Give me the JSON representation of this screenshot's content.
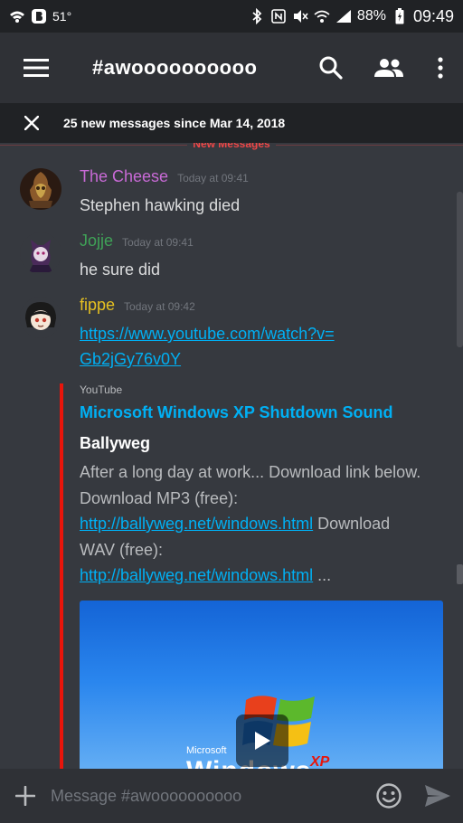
{
  "status_bar": {
    "temperature": "51°",
    "battery": "88%",
    "time": "09:49"
  },
  "header": {
    "channel_name": "#awoooooooooo"
  },
  "new_messages_bar": {
    "text": "25 new messages since Mar 14, 2018",
    "divider_label": "New Messages"
  },
  "messages": [
    {
      "author": "The Cheese",
      "author_color": "#c86ad6",
      "timestamp": "Today at 09:41",
      "text": "Stephen hawking died"
    },
    {
      "author": "Jojje",
      "author_color": "#3fa257",
      "timestamp": "Today at 09:41",
      "text": "he sure did"
    },
    {
      "author": "fippe",
      "author_color": "#e6c021",
      "timestamp": "Today at 09:42",
      "link_line1": "https://www.youtube.com/watch?v=",
      "link_line2": "Gb2jGy76v0Y"
    }
  ],
  "embed": {
    "provider": "YouTube",
    "title": "Microsoft Windows XP Shutdown Sound",
    "author": "Ballyweg",
    "desc_1": "After a long day at work... Download link below.",
    "desc_2": "Download MP3 (free):",
    "desc_link_1": "http://ballyweg.net/windows.html",
    "desc_3": " Download",
    "desc_4": "WAV (free):",
    "desc_link_2": "http://ballyweg.net/windows.html",
    "desc_5": " ...",
    "thumb_brand": "Microsoft",
    "thumb_product": "Windows",
    "thumb_edition": "XP",
    "accent_color": "#e8150b"
  },
  "composer": {
    "placeholder": "Message #awoooooooooo"
  },
  "colors": {
    "background": "#36393f",
    "header": "#2f3136",
    "link": "#00b0f4"
  }
}
